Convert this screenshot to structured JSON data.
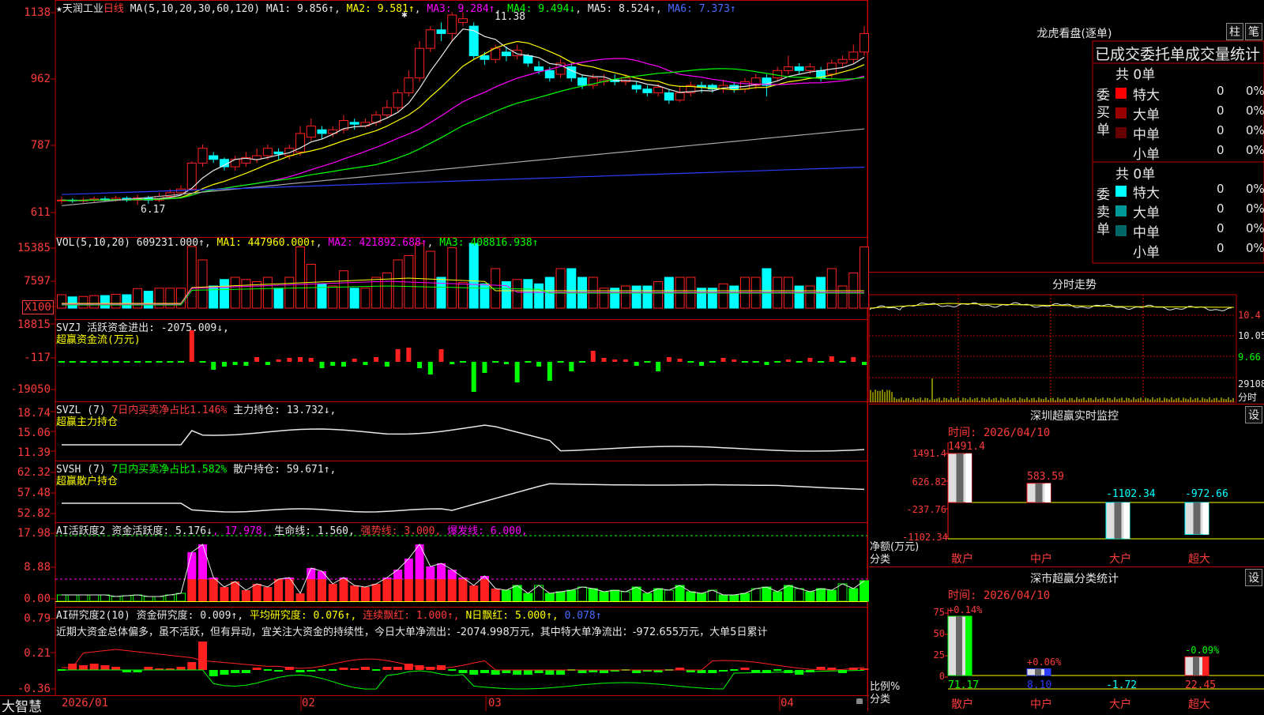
{
  "header": {
    "star": "★",
    "name": "天润工业",
    "period": "日线",
    "ma_def": "MA(5,10,20,30,60,120)",
    "ma1": "MA1: 9.856↑",
    "ma2": "MA2: 9.581↑",
    "ma3": "MA3: 9.284↑",
    "ma4": "MA4: 9.494↓",
    "ma5": "MA5: 8.524↑",
    "ma6": "MA6: 7.373↑",
    "high_mark": "11.38",
    "low_mark": "6.17"
  },
  "price_axis": [
    "1138",
    "962",
    "787",
    "611"
  ],
  "vol": {
    "axis": [
      "15385",
      "7597",
      "X100"
    ],
    "title": "VOL(5,10,20)",
    "value": "609231.000↑",
    "ma1": "MA1: 447960.000↑",
    "ma2": "MA2: 421892.688↑",
    "ma3": "MA3: 408816.938↑"
  },
  "svzj": {
    "axis": [
      "18815",
      "-117",
      "-19050"
    ],
    "title": "SVZJ",
    "label": "活跃资金进出: -2075.009↓,",
    "sub": "超赢资金流(万元)"
  },
  "svzl": {
    "axis": [
      "18.74",
      "15.06",
      "11.39"
    ],
    "title": "SVZL (7)",
    "label": "7日内买卖净占比1.146%",
    "label2": "主力持仓: 13.732↓,",
    "sub": "超赢主力持仓"
  },
  "svsh": {
    "axis": [
      "62.32",
      "57.48",
      "52.82"
    ],
    "title": "SVSH (7)",
    "label": "7日内买卖净占比1.582%",
    "label2": "散户持仓: 59.671↑,",
    "sub": "超赢散户持仓"
  },
  "ai_active": {
    "axis": [
      "17.98",
      "8.88",
      "0.00"
    ],
    "title": "AI活跃度2",
    "v1": "资金活跃度: 5.176↓",
    "v2": ", 17.978,",
    "v3": "生命线: 1.560,",
    "v4": "强势线: 3.000,",
    "v5": "爆发线: 6.000,"
  },
  "ai_research": {
    "axis": [
      "0.79",
      "0.21",
      "-0.36"
    ],
    "title": "AI研究度2(10)",
    "v1": "资金研究度: 0.009↑,",
    "v2": "平均研究度: 0.076↑,",
    "v3": "连续飘红: 1.000↑,",
    "v4": "N日飘红: 5.000↑,",
    "v5": "0.078↑",
    "comment": "近期大资金总体偏多，虽不活跃，但有异动，宜关注大资金的持续性，今日大单净流出：-2074.998万元，其中特大单净流出：-972.655万元，大单5日累计"
  },
  "bottom": {
    "logo": "大智慧",
    "dates": [
      "2026/01",
      "02",
      "03",
      "04"
    ]
  },
  "longhu": {
    "title": "龙虎看盘(逐单)",
    "btn1": "柱",
    "btn2": "笔",
    "subtitle": "已成交委托单成交量统计",
    "buy_group": "委买单",
    "sell_group": "委卖单",
    "buy_total": "共 0单",
    "sell_total": "共 0单",
    "buy_rows": [
      {
        "label": "特大",
        "count": "0",
        "pct": "0%",
        "color": "#ff0000"
      },
      {
        "label": "大单",
        "count": "0",
        "pct": "0%",
        "color": "#990000"
      },
      {
        "label": "中单",
        "count": "0",
        "pct": "0%",
        "color": "#660000"
      },
      {
        "label": "小单",
        "count": "0",
        "pct": "0%",
        "color": ""
      }
    ],
    "sell_rows": [
      {
        "label": "特大",
        "count": "0",
        "pct": "0%",
        "color": "#00ffff"
      },
      {
        "label": "大单",
        "count": "0",
        "pct": "0%",
        "color": "#009999"
      },
      {
        "label": "中单",
        "count": "0",
        "pct": "0%",
        "color": "#006666"
      },
      {
        "label": "小单",
        "count": "0",
        "pct": "0%",
        "color": ""
      }
    ]
  },
  "intraday": {
    "title": "分时走势",
    "axis": [
      "10.4",
      "10.05",
      "9.66",
      "29108",
      "分时"
    ]
  },
  "sz_monitor": {
    "title": "深圳超赢实时监控",
    "btn": "设",
    "time": "时间: 2026/04/10",
    "axis": [
      "1491.4",
      "626.82",
      "-237.76",
      "-1102.34"
    ],
    "ylabel": "净额(万元)",
    "xlabel": "分类",
    "categories": [
      "散户",
      "中户",
      "大户",
      "超大"
    ],
    "values": [
      "1491.4",
      "583.59",
      "-1102.34",
      "-972.66"
    ]
  },
  "sz_class": {
    "title": "深市超赢分类统计",
    "btn": "设",
    "time": "时间: 2026/04/10",
    "axis": [
      "75",
      "50",
      "25",
      "0"
    ],
    "ylabel": "比例%",
    "xlabel": "分类",
    "categories": [
      "散户",
      "中户",
      "大户",
      "超大"
    ],
    "top_labels": [
      "+0.14%",
      "+0.06%",
      "",
      "-0.09%"
    ],
    "values": [
      "71.17",
      "8.10",
      "-1.72",
      "22.45"
    ]
  },
  "chart_data": {
    "type": "candlestick",
    "title": "天润工业 日线",
    "ylim": [
      5.9,
      11.45
    ],
    "x": [
      "2026/01",
      "02",
      "03",
      "04"
    ],
    "candles": [
      [
        6.3,
        6.3,
        6.4,
        6.2
      ],
      [
        6.3,
        6.28,
        6.35,
        6.22
      ],
      [
        6.28,
        6.3,
        6.36,
        6.22
      ],
      [
        6.3,
        6.33,
        6.4,
        6.25
      ],
      [
        6.33,
        6.3,
        6.4,
        6.25
      ],
      [
        6.3,
        6.35,
        6.42,
        6.26
      ],
      [
        6.35,
        6.3,
        6.4,
        6.25
      ],
      [
        6.3,
        6.36,
        6.45,
        6.17
      ],
      [
        6.36,
        6.3,
        6.42,
        6.2
      ],
      [
        6.3,
        6.4,
        6.5,
        6.25
      ],
      [
        6.4,
        6.5,
        6.6,
        6.35
      ],
      [
        6.5,
        6.6,
        6.7,
        6.45
      ],
      [
        6.6,
        7.3,
        7.35,
        6.55
      ],
      [
        7.3,
        7.7,
        7.8,
        7.2
      ],
      [
        7.5,
        7.4,
        7.6,
        7.3
      ],
      [
        7.4,
        7.2,
        7.45,
        7.1
      ],
      [
        7.2,
        7.4,
        7.5,
        7.1
      ],
      [
        7.3,
        7.45,
        7.6,
        7.2
      ],
      [
        7.4,
        7.5,
        7.7,
        7.3
      ],
      [
        7.5,
        7.7,
        7.8,
        7.4
      ],
      [
        7.6,
        7.55,
        7.7,
        7.4
      ],
      [
        7.5,
        7.7,
        7.8,
        7.4
      ],
      [
        7.6,
        8.1,
        8.3,
        7.5
      ],
      [
        8.0,
        8.3,
        8.5,
        7.9
      ],
      [
        8.2,
        8.1,
        8.3,
        7.95
      ],
      [
        8.1,
        8.2,
        8.3,
        8.0
      ],
      [
        8.2,
        8.45,
        8.6,
        8.1
      ],
      [
        8.4,
        8.35,
        8.5,
        8.2
      ],
      [
        8.3,
        8.4,
        8.5,
        8.25
      ],
      [
        8.4,
        8.6,
        8.7,
        8.3
      ],
      [
        8.6,
        8.8,
        9.0,
        8.5
      ],
      [
        8.8,
        9.2,
        9.3,
        8.7
      ],
      [
        9.2,
        9.6,
        9.8,
        9.1
      ],
      [
        9.6,
        10.4,
        10.6,
        9.5
      ],
      [
        10.4,
        10.9,
        11.0,
        10.3
      ],
      [
        10.9,
        10.8,
        11.1,
        10.6
      ],
      [
        10.8,
        11.3,
        11.38,
        10.6
      ],
      [
        11.1,
        11.2,
        11.38,
        11.0
      ],
      [
        11.0,
        10.2,
        11.1,
        10.1
      ],
      [
        10.2,
        10.1,
        10.3,
        9.95
      ],
      [
        10.1,
        10.4,
        10.5,
        10.0
      ],
      [
        10.3,
        10.2,
        10.45,
        10.05
      ],
      [
        10.2,
        10.35,
        10.5,
        10.1
      ],
      [
        10.2,
        10.0,
        10.25,
        9.9
      ],
      [
        9.9,
        9.8,
        10.05,
        9.7
      ],
      [
        9.8,
        9.6,
        9.9,
        9.5
      ],
      [
        9.7,
        10.0,
        10.1,
        9.6
      ],
      [
        9.9,
        9.6,
        10.0,
        9.5
      ],
      [
        9.6,
        9.4,
        9.7,
        9.3
      ],
      [
        9.4,
        9.6,
        9.7,
        9.3
      ],
      [
        9.5,
        9.55,
        9.7,
        9.4
      ],
      [
        9.55,
        9.5,
        9.7,
        9.4
      ],
      [
        9.5,
        9.6,
        9.7,
        9.4
      ],
      [
        9.4,
        9.3,
        9.5,
        9.2
      ],
      [
        9.3,
        9.2,
        9.4,
        9.1
      ],
      [
        9.2,
        9.35,
        9.45,
        9.1
      ],
      [
        9.2,
        9.0,
        9.3,
        8.9
      ],
      [
        9.0,
        9.2,
        9.35,
        8.95
      ],
      [
        9.2,
        9.4,
        9.5,
        9.1
      ],
      [
        9.4,
        9.35,
        9.5,
        9.2
      ],
      [
        9.4,
        9.3,
        9.45,
        9.2
      ],
      [
        9.3,
        9.4,
        9.55,
        9.2
      ],
      [
        9.4,
        9.3,
        9.5,
        9.2
      ],
      [
        9.3,
        9.5,
        9.6,
        9.2
      ],
      [
        9.4,
        9.6,
        9.7,
        9.3
      ],
      [
        9.6,
        9.4,
        9.7,
        9.1
      ],
      [
        9.6,
        9.8,
        9.9,
        9.5
      ],
      [
        9.8,
        9.9,
        10.2,
        9.7
      ],
      [
        9.9,
        9.8,
        10.0,
        9.7
      ],
      [
        9.8,
        9.9,
        10.0,
        9.7
      ],
      [
        9.8,
        9.6,
        9.9,
        9.5
      ],
      [
        9.7,
        10.0,
        10.1,
        9.6
      ],
      [
        10.0,
        10.1,
        10.2,
        9.9
      ],
      [
        10.1,
        10.3,
        10.5,
        10.0
      ],
      [
        10.3,
        10.8,
        11.0,
        10.2
      ]
    ],
    "ma_series": [
      {
        "name": "MA1",
        "color": "#e8e8e8"
      },
      {
        "name": "MA2",
        "color": "#ffff00"
      },
      {
        "name": "MA3",
        "color": "#ff00ff"
      },
      {
        "name": "MA4",
        "color": "#00ff00"
      },
      {
        "name": "MA5",
        "color": "#aaaaaa"
      },
      {
        "name": "MA6",
        "color": "#2b3cff"
      }
    ]
  }
}
